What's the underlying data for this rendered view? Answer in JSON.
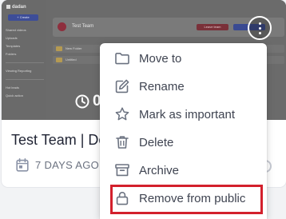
{
  "thumbnail": {
    "sidebar": {
      "logo_text": "dadan",
      "create_label": "+ Create",
      "nav_items": [
        "Shared videos",
        "Uploads",
        "Templates",
        "Folders",
        "Viewing Reporting",
        "Hot leads",
        "Quick action"
      ]
    },
    "header": {
      "workspace_title": "Test Team",
      "red_button_label": "Leave team"
    },
    "rows": [
      "New Folder",
      "Untitled"
    ]
  },
  "card": {
    "duration_text": "0",
    "title": "Test Team | De",
    "date_text": "7 DAYS AGO"
  },
  "menu": {
    "items": [
      {
        "label": "Move to",
        "icon": "folder-icon"
      },
      {
        "label": "Rename",
        "icon": "pencil-icon"
      },
      {
        "label": "Mark as important",
        "icon": "star-icon"
      },
      {
        "label": "Delete",
        "icon": "trash-icon"
      },
      {
        "label": "Archive",
        "icon": "archive-box-icon"
      },
      {
        "label": "Remove from public",
        "icon": "lock-icon"
      }
    ]
  },
  "colors": {
    "highlight": "#d3202c",
    "title_text": "#1f2333",
    "menu_text": "#3f4451",
    "date_icon": "#8b93a7"
  }
}
